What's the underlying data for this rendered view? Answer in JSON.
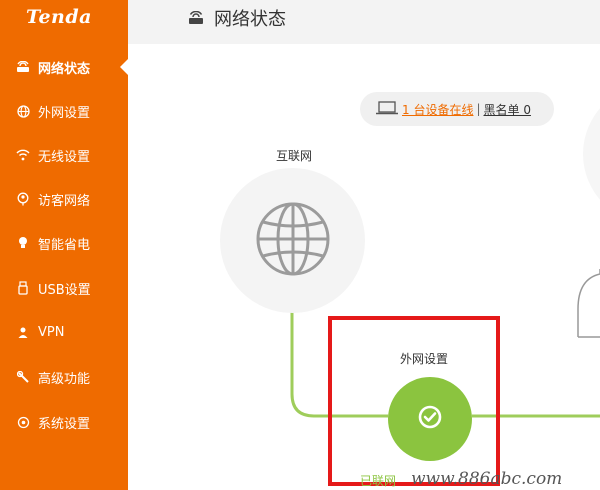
{
  "brand": {
    "logo_text": "Tenda"
  },
  "sidebar": {
    "items": [
      {
        "label": "网络状态",
        "icon": "router-icon"
      },
      {
        "label": "外网设置",
        "icon": "globe-icon"
      },
      {
        "label": "无线设置",
        "icon": "wifi-icon"
      },
      {
        "label": "访客网络",
        "icon": "guest-icon"
      },
      {
        "label": "智能省电",
        "icon": "bulb-icon"
      },
      {
        "label": "USB设置",
        "icon": "usb-icon"
      },
      {
        "label": "VPN",
        "icon": "vpn-icon"
      },
      {
        "label": "高级功能",
        "icon": "wrench-icon"
      },
      {
        "label": "系统设置",
        "icon": "gear-icon"
      }
    ],
    "active_index": 0
  },
  "header": {
    "title": "网络状态"
  },
  "status": {
    "online_link": "1 台设备在线",
    "separator": "|",
    "blacklist_link": "黑名单 0"
  },
  "topology": {
    "internet_label": "互联网",
    "wan_label": "外网设置",
    "wan_status": "已联网"
  },
  "watermark": "www.886abc.com",
  "colors": {
    "accent": "#ef6b00",
    "success": "#8bc43f",
    "highlight_box": "#e51919"
  }
}
